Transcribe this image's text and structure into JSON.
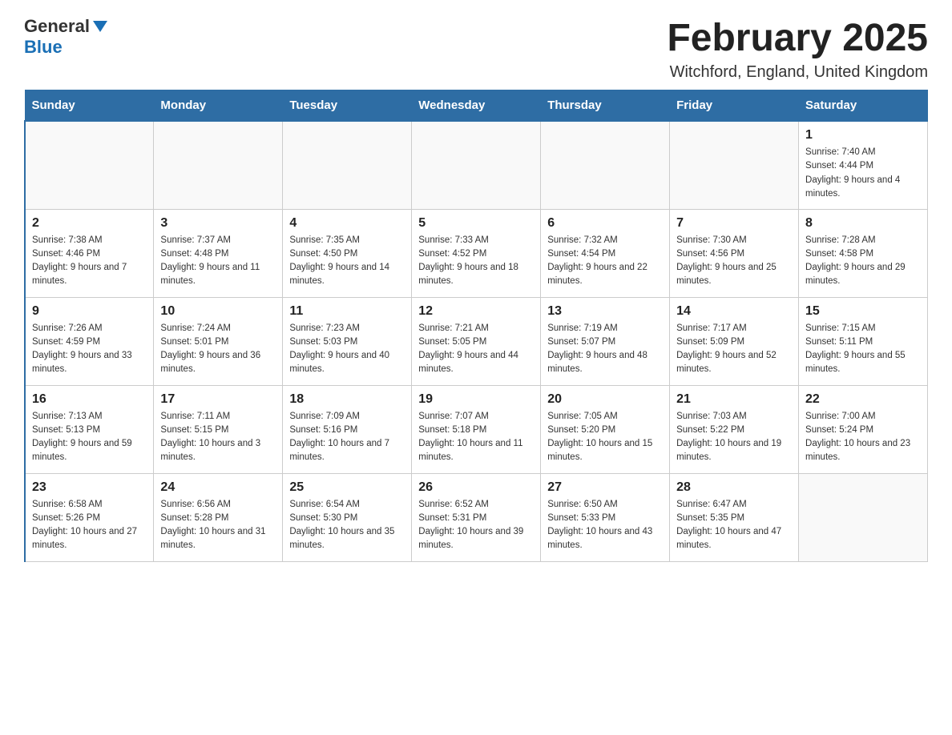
{
  "logo": {
    "general": "General",
    "blue": "Blue"
  },
  "title": "February 2025",
  "subtitle": "Witchford, England, United Kingdom",
  "days_of_week": [
    "Sunday",
    "Monday",
    "Tuesday",
    "Wednesday",
    "Thursday",
    "Friday",
    "Saturday"
  ],
  "weeks": [
    [
      {
        "day": "",
        "info": ""
      },
      {
        "day": "",
        "info": ""
      },
      {
        "day": "",
        "info": ""
      },
      {
        "day": "",
        "info": ""
      },
      {
        "day": "",
        "info": ""
      },
      {
        "day": "",
        "info": ""
      },
      {
        "day": "1",
        "info": "Sunrise: 7:40 AM\nSunset: 4:44 PM\nDaylight: 9 hours and 4 minutes."
      }
    ],
    [
      {
        "day": "2",
        "info": "Sunrise: 7:38 AM\nSunset: 4:46 PM\nDaylight: 9 hours and 7 minutes."
      },
      {
        "day": "3",
        "info": "Sunrise: 7:37 AM\nSunset: 4:48 PM\nDaylight: 9 hours and 11 minutes."
      },
      {
        "day": "4",
        "info": "Sunrise: 7:35 AM\nSunset: 4:50 PM\nDaylight: 9 hours and 14 minutes."
      },
      {
        "day": "5",
        "info": "Sunrise: 7:33 AM\nSunset: 4:52 PM\nDaylight: 9 hours and 18 minutes."
      },
      {
        "day": "6",
        "info": "Sunrise: 7:32 AM\nSunset: 4:54 PM\nDaylight: 9 hours and 22 minutes."
      },
      {
        "day": "7",
        "info": "Sunrise: 7:30 AM\nSunset: 4:56 PM\nDaylight: 9 hours and 25 minutes."
      },
      {
        "day": "8",
        "info": "Sunrise: 7:28 AM\nSunset: 4:58 PM\nDaylight: 9 hours and 29 minutes."
      }
    ],
    [
      {
        "day": "9",
        "info": "Sunrise: 7:26 AM\nSunset: 4:59 PM\nDaylight: 9 hours and 33 minutes."
      },
      {
        "day": "10",
        "info": "Sunrise: 7:24 AM\nSunset: 5:01 PM\nDaylight: 9 hours and 36 minutes."
      },
      {
        "day": "11",
        "info": "Sunrise: 7:23 AM\nSunset: 5:03 PM\nDaylight: 9 hours and 40 minutes."
      },
      {
        "day": "12",
        "info": "Sunrise: 7:21 AM\nSunset: 5:05 PM\nDaylight: 9 hours and 44 minutes."
      },
      {
        "day": "13",
        "info": "Sunrise: 7:19 AM\nSunset: 5:07 PM\nDaylight: 9 hours and 48 minutes."
      },
      {
        "day": "14",
        "info": "Sunrise: 7:17 AM\nSunset: 5:09 PM\nDaylight: 9 hours and 52 minutes."
      },
      {
        "day": "15",
        "info": "Sunrise: 7:15 AM\nSunset: 5:11 PM\nDaylight: 9 hours and 55 minutes."
      }
    ],
    [
      {
        "day": "16",
        "info": "Sunrise: 7:13 AM\nSunset: 5:13 PM\nDaylight: 9 hours and 59 minutes."
      },
      {
        "day": "17",
        "info": "Sunrise: 7:11 AM\nSunset: 5:15 PM\nDaylight: 10 hours and 3 minutes."
      },
      {
        "day": "18",
        "info": "Sunrise: 7:09 AM\nSunset: 5:16 PM\nDaylight: 10 hours and 7 minutes."
      },
      {
        "day": "19",
        "info": "Sunrise: 7:07 AM\nSunset: 5:18 PM\nDaylight: 10 hours and 11 minutes."
      },
      {
        "day": "20",
        "info": "Sunrise: 7:05 AM\nSunset: 5:20 PM\nDaylight: 10 hours and 15 minutes."
      },
      {
        "day": "21",
        "info": "Sunrise: 7:03 AM\nSunset: 5:22 PM\nDaylight: 10 hours and 19 minutes."
      },
      {
        "day": "22",
        "info": "Sunrise: 7:00 AM\nSunset: 5:24 PM\nDaylight: 10 hours and 23 minutes."
      }
    ],
    [
      {
        "day": "23",
        "info": "Sunrise: 6:58 AM\nSunset: 5:26 PM\nDaylight: 10 hours and 27 minutes."
      },
      {
        "day": "24",
        "info": "Sunrise: 6:56 AM\nSunset: 5:28 PM\nDaylight: 10 hours and 31 minutes."
      },
      {
        "day": "25",
        "info": "Sunrise: 6:54 AM\nSunset: 5:30 PM\nDaylight: 10 hours and 35 minutes."
      },
      {
        "day": "26",
        "info": "Sunrise: 6:52 AM\nSunset: 5:31 PM\nDaylight: 10 hours and 39 minutes."
      },
      {
        "day": "27",
        "info": "Sunrise: 6:50 AM\nSunset: 5:33 PM\nDaylight: 10 hours and 43 minutes."
      },
      {
        "day": "28",
        "info": "Sunrise: 6:47 AM\nSunset: 5:35 PM\nDaylight: 10 hours and 47 minutes."
      },
      {
        "day": "",
        "info": ""
      }
    ]
  ]
}
